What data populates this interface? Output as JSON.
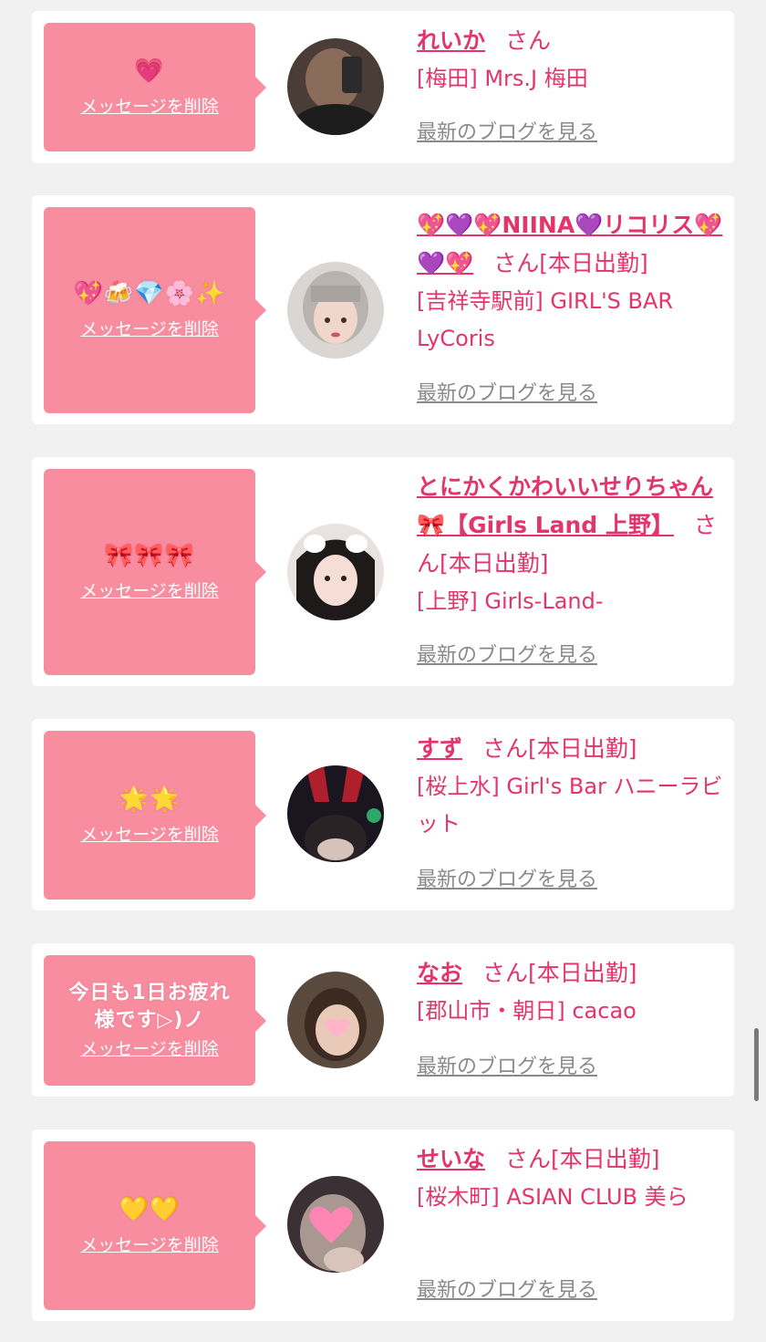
{
  "entries": [
    {
      "message": "💗",
      "delete_label": "メッセージを削除",
      "name": "れいか",
      "honorific": "さん",
      "badge": "",
      "shop": "[梅田] Mrs.J 梅田",
      "blog_label": "最新のブログを見る",
      "avatar_icon": "avatar-photo"
    },
    {
      "message": "💖🍻💎🌸✨",
      "delete_label": "メッセージを削除",
      "name": "💖💜💖NIINA💜リコリス💖💜💖",
      "honorific": "さん",
      "badge": "[本日出勤]",
      "shop": "[吉祥寺駅前] GIRL'S BAR LyCoris",
      "blog_label": "最新のブログを見る",
      "avatar_icon": "avatar-photo"
    },
    {
      "message": "🎀🎀🎀",
      "delete_label": "メッセージを削除",
      "name": "とにかくかわいいせりちゃん🎀【Girls Land 上野】",
      "honorific": "さん",
      "badge": "[本日出勤]",
      "shop": "[上野] Girls-Land-",
      "blog_label": "最新のブログを見る",
      "avatar_icon": "avatar-photo"
    },
    {
      "message": "🌟🌟",
      "delete_label": "メッセージを削除",
      "name": "すず",
      "honorific": "さん",
      "badge": "[本日出勤]",
      "shop": "[桜上水] Girl's Bar ハニーラビット",
      "blog_label": "最新のブログを見る",
      "avatar_icon": "avatar-photo"
    },
    {
      "message": "今日も1日お疲れ様です▷)ノ",
      "delete_label": "メッセージを削除",
      "name": "なお",
      "honorific": "さん",
      "badge": "[本日出勤]",
      "shop": "[郡山市・朝日] cacao",
      "blog_label": "最新のブログを見る",
      "avatar_icon": "avatar-photo"
    },
    {
      "message": "💛💛",
      "delete_label": "メッセージを削除",
      "name": "せいな",
      "honorific": "さん",
      "badge": "[本日出勤]",
      "shop": "[桜木町] ASIAN CLUB 美ら",
      "blog_label": "最新のブログを見る",
      "avatar_icon": "avatar-photo"
    }
  ],
  "colors": {
    "accent": "#e3356b",
    "bubble": "#f98da0",
    "card": "#ffffff",
    "background": "#f1f1f1",
    "muted_link": "#8a8a8a"
  }
}
